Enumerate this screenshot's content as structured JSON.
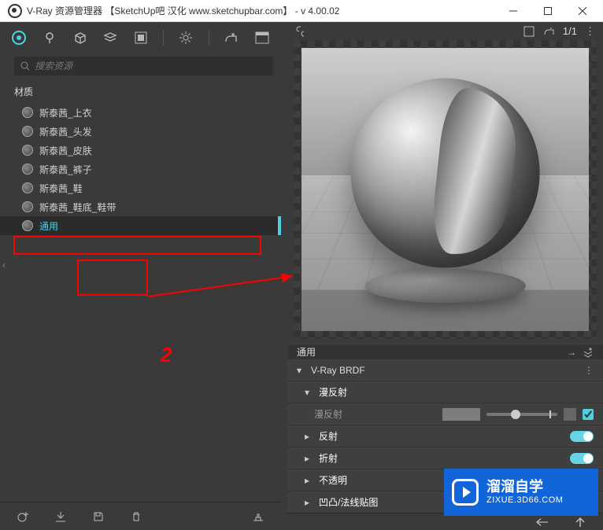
{
  "titlebar": {
    "title": "V-Ray 资源管理器  【SketchUp吧 汉化 www.sketchupbar.com】 - v 4.00.02"
  },
  "search": {
    "placeholder": "搜索资源"
  },
  "section": {
    "materials_label": "材质"
  },
  "materials": [
    {
      "name": "斯泰茜_上衣"
    },
    {
      "name": "斯泰茜_头发"
    },
    {
      "name": "斯泰茜_皮肤"
    },
    {
      "name": "斯泰茜_裤子"
    },
    {
      "name": "斯泰茜_鞋"
    },
    {
      "name": "斯泰茜_鞋底_鞋带"
    },
    {
      "name": "通用"
    }
  ],
  "selected_index": 6,
  "right": {
    "ratio": "1/1",
    "header_title": "通用",
    "brdf_title": "V-Ray BRDF",
    "diffuse_section": "漫反射",
    "diffuse_label": "漫反射",
    "reflection_label": "反射",
    "refraction_label": "折射",
    "opacity_label": "不透明",
    "bump_label": "凹凸/法线贴图"
  },
  "colors": {
    "accent": "#4ed0e0",
    "annotation": "#ff0000",
    "watermark_bg": "#1265d8"
  },
  "annotation": {
    "number": "2"
  },
  "watermark": {
    "brand": "溜溜自学",
    "url": "ZIXUE.3D66.COM"
  }
}
